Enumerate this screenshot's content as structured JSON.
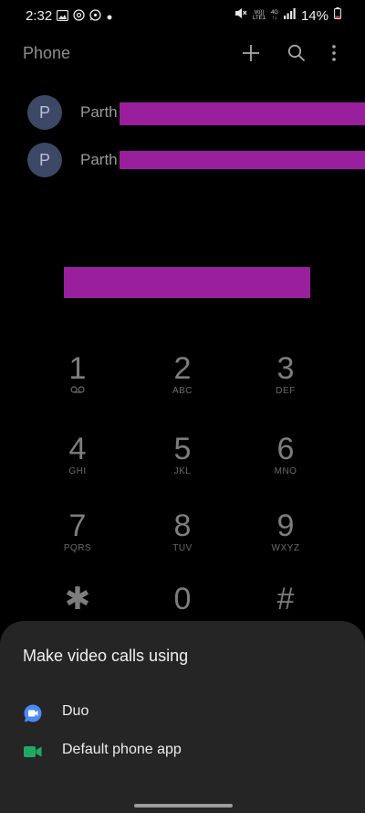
{
  "status": {
    "time": "2:32",
    "battery": "14%",
    "volte_top": "Vo))",
    "volte_bottom": "LTE1",
    "net_top": "4G",
    "net_bottom": "↑↓"
  },
  "app": {
    "title": "Phone"
  },
  "contacts": [
    {
      "initial": "P",
      "name": "Parth"
    },
    {
      "initial": "P",
      "name": "Parth"
    }
  ],
  "dialpad": [
    {
      "digit": "1",
      "letters": ""
    },
    {
      "digit": "2",
      "letters": "ABC"
    },
    {
      "digit": "3",
      "letters": "DEF"
    },
    {
      "digit": "4",
      "letters": "GHI"
    },
    {
      "digit": "5",
      "letters": "JKL"
    },
    {
      "digit": "6",
      "letters": "MNO"
    },
    {
      "digit": "7",
      "letters": "PQRS"
    },
    {
      "digit": "8",
      "letters": "TUV"
    },
    {
      "digit": "9",
      "letters": "WXYZ"
    },
    {
      "digit": "✱",
      "letters": ""
    },
    {
      "digit": "0",
      "letters": ""
    },
    {
      "digit": "#",
      "letters": ""
    }
  ],
  "sheet": {
    "title": "Make video calls using",
    "options": [
      {
        "label": "Duo",
        "icon": "duo-icon"
      },
      {
        "label": "Default phone app",
        "icon": "video-camera-icon"
      }
    ]
  },
  "colors": {
    "redaction": "#9a1f9c",
    "duo": "#4a8af4",
    "phone_video": "#1faa62"
  }
}
